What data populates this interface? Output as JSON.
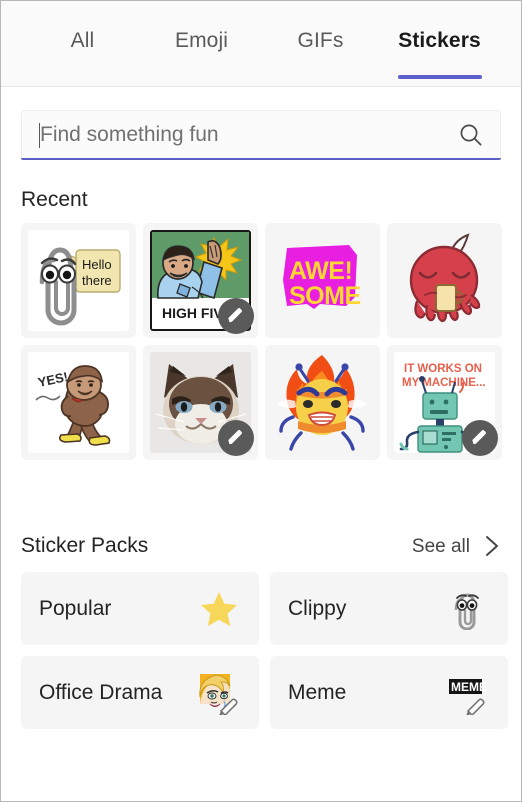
{
  "tabs": [
    {
      "label": "All",
      "active": false
    },
    {
      "label": "Emoji",
      "active": false
    },
    {
      "label": "GIFs",
      "active": false
    },
    {
      "label": "Stickers",
      "active": true
    }
  ],
  "search": {
    "placeholder": "Find something fun",
    "value": "",
    "icon": "search-icon"
  },
  "recent": {
    "title": "Recent",
    "stickers": [
      {
        "name": "clippy-hello-there",
        "caption": "Hello there",
        "editable": false
      },
      {
        "name": "high-five-comic",
        "caption": "HIGH FIVE",
        "editable": true
      },
      {
        "name": "awesome",
        "caption": "AWE! SOME",
        "editable": false
      },
      {
        "name": "red-character-mug",
        "caption": "",
        "editable": false
      },
      {
        "name": "monkey-yes",
        "caption": "YES!",
        "editable": false
      },
      {
        "name": "grumpy-cat",
        "caption": "",
        "editable": true
      },
      {
        "name": "angry-fire-bee",
        "caption": "",
        "editable": false
      },
      {
        "name": "robot-it-works",
        "caption": "IT WORKS ON MY MACHINE...",
        "editable": true
      }
    ]
  },
  "packs": {
    "title": "Sticker Packs",
    "see_all_label": "See all",
    "see_all_icon": "chevron-right-icon",
    "items": [
      {
        "label": "Popular",
        "icon": "star-icon"
      },
      {
        "label": "Clippy",
        "icon": "paperclip-icon"
      },
      {
        "label": "Office Drama",
        "icon": "popart-woman-pencil-icon"
      },
      {
        "label": "Meme",
        "icon": "meme-pencil-icon"
      }
    ]
  },
  "colors": {
    "accent": "#5b5fc7",
    "tile_bg": "#f5f5f5",
    "text": "#242424",
    "muted_text": "#5a5a5a",
    "star": "#f7d75a",
    "magenta": "#e51ee0",
    "yellow": "#ffd633"
  }
}
